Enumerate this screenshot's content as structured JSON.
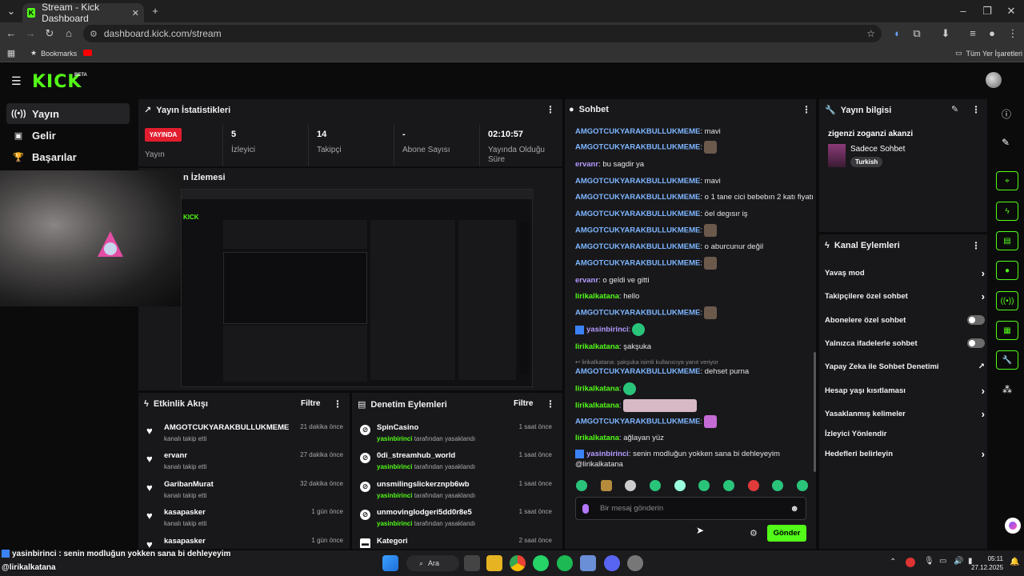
{
  "browser": {
    "tab_title": "Stream - Kick Dashboard",
    "url": "dashboard.kick.com/stream",
    "bookmarks_label": "Bookmarks",
    "other_bookmarks": "Tüm Yer İşaretleri"
  },
  "app": {
    "logo": "KICK",
    "beta": "BETA"
  },
  "sidebar": {
    "items": [
      {
        "label": "Yayın",
        "icon": "broadcast-icon"
      },
      {
        "label": "Gelir",
        "icon": "revenue-icon"
      },
      {
        "label": "Başarılar",
        "icon": "trophy-icon"
      }
    ]
  },
  "stats": {
    "title": "Yayın İstatistikleri",
    "live_badge": "YAYINDA",
    "live_label": "Yayın",
    "viewers_value": "5",
    "viewers_label": "İzleyici",
    "followers_value": "14",
    "followers_label": "Takipçi",
    "subs_value": "-",
    "subs_label": "Abone Sayısı",
    "uptime_value": "02:10:57",
    "uptime_label": "Yayında Olduğu Süre"
  },
  "preview": {
    "title": "n İzlemesi"
  },
  "chat": {
    "title": "Sohbet",
    "messages": [
      {
        "user": "AMGOTCUKYARAKBULLUKMEME",
        "text": ": mavi"
      },
      {
        "user": "AMGOTCUKYARAKBULLUKMEME",
        "text": ":"
      },
      {
        "user": "ervanr",
        "text": ": bu sagdir ya"
      },
      {
        "user": "AMGOTCUKYARAKBULLUKMEME",
        "text": ": mavi"
      },
      {
        "user": "AMGOTCUKYARAKBULLUKMEME",
        "text": ": o 1 tane cici bebebın 2 katı fiyatı"
      },
      {
        "user": "AMGOTCUKYARAKBULLUKMEME",
        "text": ": öel degısır iş"
      },
      {
        "user": "AMGOTCUKYARAKBULLUKMEME",
        "text": ":"
      },
      {
        "user": "AMGOTCUKYARAKBULLUKMEME",
        "text": ": o aburcunur değil"
      },
      {
        "user": "AMGOTCUKYARAKBULLUKMEME",
        "text": ":"
      },
      {
        "user": "ervanr",
        "text": ": o geldi ve gitti"
      },
      {
        "user": "lirikalkatana",
        "text": ": hello"
      },
      {
        "user": "AMGOTCUKYARAKBULLUKMEME",
        "text": ":"
      },
      {
        "user": "yasinbirinci",
        "text": ":"
      },
      {
        "user": "lirikalkatana",
        "text": ": şakşuka"
      },
      {
        "reply": "lirikalkatana: şakşuka isimli kullanıcıya yanıt veriyor"
      },
      {
        "user": "AMGOTCUKYARAKBULLUKMEME",
        "text": ": dehset purna"
      },
      {
        "user": "lirikalkatana",
        "text": ":"
      },
      {
        "user": "lirikalkatana",
        "text": ":"
      },
      {
        "user": "AMGOTCUKYARAKBULLUKMEME",
        "text": ":"
      },
      {
        "user": "lirikalkatana",
        "text": ": ağlayan yüz"
      },
      {
        "user": "yasinbirinci",
        "text": ": senin modluğun yokken sana bi dehleyeyim"
      },
      {
        "text": "@lirikalkatana"
      }
    ],
    "input_placeholder": "Bir mesaj gönderin",
    "send_label": "Gönder"
  },
  "stream_info": {
    "title": "Yayın bilgisi",
    "stream_title": "zigenzi zoganzi akanzi",
    "category": "Sadece Sohbet",
    "tag": "Turkish"
  },
  "channel_actions": {
    "title": "Kanal Eylemleri",
    "items": [
      {
        "label": "Yavaş mod",
        "control": "chevron"
      },
      {
        "label": "Takipçilere özel sohbet",
        "control": "chevron"
      },
      {
        "label": "Abonelere özel sohbet",
        "control": "toggle"
      },
      {
        "label": "Yalnızca ifadelerle sohbet",
        "control": "toggle"
      },
      {
        "label": "Yapay Zeka ile Sohbet Denetimi",
        "control": "external"
      },
      {
        "label": "Hesap yaşı kısıtlaması",
        "control": "chevron"
      },
      {
        "label": "Yasaklanmış kelimeler",
        "control": "chevron"
      },
      {
        "label": "İzleyici Yönlendir",
        "control": "none"
      },
      {
        "label": "Hedefleri belirleyin",
        "control": "chevron"
      }
    ]
  },
  "activity": {
    "title": "Etkinlik Akışı",
    "filter": "Filtre",
    "items": [
      {
        "name": "AMGOTCUKYARAKBULLUKMEME",
        "sub": "kanalı takip etti",
        "time": "21 dakika önce"
      },
      {
        "name": "ervanr",
        "sub": "kanalı takip etti",
        "time": "27 dakika önce"
      },
      {
        "name": "GaribanMurat",
        "sub": "kanalı takip etti",
        "time": "32 dakika önce"
      },
      {
        "name": "kasapasker",
        "sub": "kanalı takip etti",
        "time": "1 gün önce"
      },
      {
        "name": "kasapasker",
        "sub": "",
        "time": "1 gün önce"
      }
    ]
  },
  "moderation": {
    "title": "Denetim Eylemleri",
    "filter": "Filtre",
    "items": [
      {
        "name": "SpinCasino",
        "mod": "yasinbirinci",
        "sub": " tarafından yasaklandı",
        "time": "1 saat önce"
      },
      {
        "name": "0di_streamhub_world",
        "mod": "yasinbirinci",
        "sub": " tarafından yasaklandı",
        "time": "1 saat önce"
      },
      {
        "name": "unsmilingslickerznpb6wb",
        "mod": "yasinbirinci",
        "sub": " tarafından yasaklandı",
        "time": "1 saat önce"
      },
      {
        "name": "unmovingIodgeri5dd0r8e5",
        "mod": "yasinbirinci",
        "sub": " tarafından yasaklandı",
        "time": "1 saat önce"
      },
      {
        "name": "Kategori",
        "mod": "",
        "sub": "",
        "time": "2 saat önce"
      }
    ]
  },
  "overlay": {
    "user": "yasinbirinci",
    "text": " : senin modluğun yokken sana bi dehleyeyim",
    "mention": "@lirikalkatana"
  },
  "taskbar": {
    "search": "Ara",
    "time": "05:11",
    "date": "27.12.2025"
  }
}
